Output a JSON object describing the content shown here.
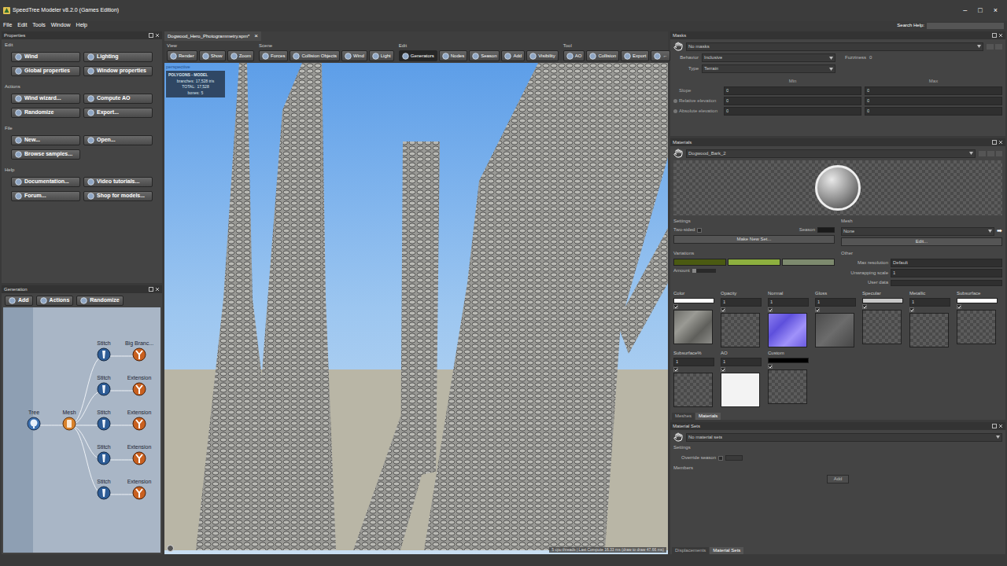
{
  "window": {
    "title": "SpeedTree Modeler v8.2.0 (Games Edition)",
    "controls": [
      "–",
      "□",
      "×"
    ]
  },
  "menu": [
    "File",
    "Edit",
    "Tools",
    "Window",
    "Help"
  ],
  "search": {
    "label": "Search Help:"
  },
  "properties": {
    "title": "Properties",
    "sections": [
      {
        "title": "Edit",
        "buttons": [
          "Wind",
          "Lighting",
          "Global properties",
          "Window properties"
        ]
      },
      {
        "title": "Actions",
        "buttons": [
          "Wind wizard...",
          "Compute AO",
          "Randomize",
          "Export..."
        ]
      },
      {
        "title": "File",
        "buttons": [
          "New...",
          "Open...",
          "Browse samples..."
        ]
      },
      {
        "title": "Help",
        "buttons": [
          "Documentation...",
          "Video tutorials...",
          "Forum...",
          "Shop for models..."
        ]
      }
    ]
  },
  "generation": {
    "title": "Generation",
    "toolbar": [
      "Add",
      "Actions",
      "Randomize"
    ],
    "nodes": [
      {
        "label": "Tree",
        "kind": "tree"
      },
      {
        "label": "Mesh",
        "kind": "mesh"
      },
      {
        "label": "Stitch",
        "kind": "stitch"
      },
      {
        "label": "Stitch",
        "kind": "stitch"
      },
      {
        "label": "Stitch",
        "kind": "stitch"
      },
      {
        "label": "Stitch",
        "kind": "stitch"
      },
      {
        "label": "Stitch",
        "kind": "stitch"
      },
      {
        "label": "Big Branc...",
        "kind": "branch"
      },
      {
        "label": "Extension",
        "kind": "branch"
      },
      {
        "label": "Extension",
        "kind": "branch"
      },
      {
        "label": "Extension",
        "kind": "branch"
      },
      {
        "label": "Extension",
        "kind": "branch"
      }
    ]
  },
  "document": {
    "tab": "Dogwood_Hero_Photogrammetry.spm*",
    "close": "×"
  },
  "toolbar": {
    "groups": [
      {
        "label": "View",
        "buttons": [
          {
            "label": "Render",
            "selected": false
          },
          {
            "label": "Show",
            "selected": false
          },
          {
            "label": "Zoom",
            "selected": false
          }
        ]
      },
      {
        "label": "Scene",
        "buttons": [
          {
            "label": "Forces",
            "selected": false
          },
          {
            "label": "Collision Objects",
            "selected": false
          },
          {
            "label": "Wind",
            "selected": false
          },
          {
            "label": "Light",
            "selected": false
          }
        ]
      },
      {
        "label": "Edit",
        "buttons": [
          {
            "label": "Generators",
            "selected": true
          },
          {
            "label": "Nodes",
            "selected": false
          },
          {
            "label": "Season",
            "selected": false
          },
          {
            "label": "Add",
            "selected": false
          },
          {
            "label": "Visibility",
            "selected": false
          }
        ]
      },
      {
        "label": "Tool",
        "buttons": [
          {
            "label": "AO",
            "selected": false
          },
          {
            "label": "Collision",
            "selected": false
          },
          {
            "label": "Export",
            "selected": false
          },
          {
            "label": "←",
            "selected": false
          }
        ]
      }
    ]
  },
  "viewport": {
    "camera": "perspective",
    "stats": {
      "title": "POLYGONS - MODEL",
      "lines": [
        {
          "label": "branches:",
          "value": "17,528 tris"
        },
        {
          "label": "TOTAL:",
          "value": "17,528"
        },
        {
          "label": "bones:",
          "value": "5"
        }
      ]
    },
    "status": "5 cpu threads | Last Compute 16.33 ms (draw to draw 47.66 ms)"
  },
  "masks": {
    "title": "Masks",
    "select": "No masks",
    "behavior": {
      "label": "Behavior",
      "value": "Inclusive"
    },
    "fuzziness": {
      "label": "Fuzziness",
      "value": "0"
    },
    "type": {
      "label": "Type",
      "value": "Terrain"
    },
    "columns": [
      "Min",
      "Max"
    ],
    "rows": [
      {
        "label": "Slope",
        "min": "0",
        "max": "0",
        "kind": "plain"
      },
      {
        "label": "Relative elevation",
        "min": "0",
        "max": "0",
        "kind": "radio"
      },
      {
        "label": "Absolute elevation",
        "min": "0",
        "max": "0",
        "kind": "radio"
      }
    ]
  },
  "materials": {
    "title": "Materials",
    "select": "Dogwood_Bark_2",
    "settings": {
      "label": "Settings",
      "two_sided": {
        "label": "Two-sided",
        "checked": false
      },
      "season": {
        "label": "Season",
        "color": "#1a1a1a"
      },
      "button": "Make New Set..."
    },
    "mesh": {
      "label": "Mesh",
      "value": "None",
      "arrow": "➡",
      "button": "Edit..."
    },
    "variations": {
      "label": "Variations",
      "colors": [
        "#4b5a12",
        "#8db03f",
        "#7d8a6e"
      ],
      "amount": {
        "label": "Amount",
        "level": 0.0
      }
    },
    "other": {
      "label": "Other",
      "fields": [
        {
          "label": "Max resolution",
          "value": "Default"
        },
        {
          "label": "Unwrapping scale",
          "value": "1"
        },
        {
          "label": "User data",
          "value": ""
        }
      ]
    },
    "slots": [
      {
        "name": "Color",
        "kind": "swatch",
        "swatch": "#ffffff",
        "checked": true,
        "preview": "bark"
      },
      {
        "name": "Opacity",
        "kind": "value",
        "value": "1",
        "checked": true,
        "preview": "empty"
      },
      {
        "name": "Normal",
        "kind": "value",
        "value": "1",
        "checked": true,
        "preview": "normal"
      },
      {
        "name": "Gloss",
        "kind": "value",
        "value": "1",
        "checked": true,
        "preview": "gloss"
      },
      {
        "name": "Specular",
        "kind": "swatch",
        "swatch": "#c8c8c8",
        "checked": true,
        "preview": "empty"
      },
      {
        "name": "Metallic",
        "kind": "value",
        "value": "1",
        "checked": true,
        "preview": "empty"
      },
      {
        "name": "Subsurface",
        "kind": "swatch",
        "swatch": "#ffffff",
        "checked": true,
        "preview": "empty"
      },
      {
        "name": "Subsurface%",
        "kind": "value",
        "value": "1",
        "checked": true,
        "preview": "empty"
      },
      {
        "name": "AO",
        "kind": "value",
        "value": "1",
        "checked": true,
        "preview": "white"
      },
      {
        "name": "Custom",
        "kind": "swatch",
        "swatch": "#000000",
        "checked": true,
        "preview": "empty"
      }
    ],
    "tabs": [
      {
        "label": "Meshes",
        "selected": false
      },
      {
        "label": "Materials",
        "selected": true
      }
    ]
  },
  "material_sets": {
    "title": "Material Sets",
    "select": "No material sets",
    "settings": "Settings",
    "override": {
      "label": "Override season",
      "checked": false
    },
    "members": "Members",
    "button": "Add",
    "tabs": [
      {
        "label": "Displacements",
        "selected": false
      },
      {
        "label": "Material Sets",
        "selected": true
      }
    ]
  }
}
